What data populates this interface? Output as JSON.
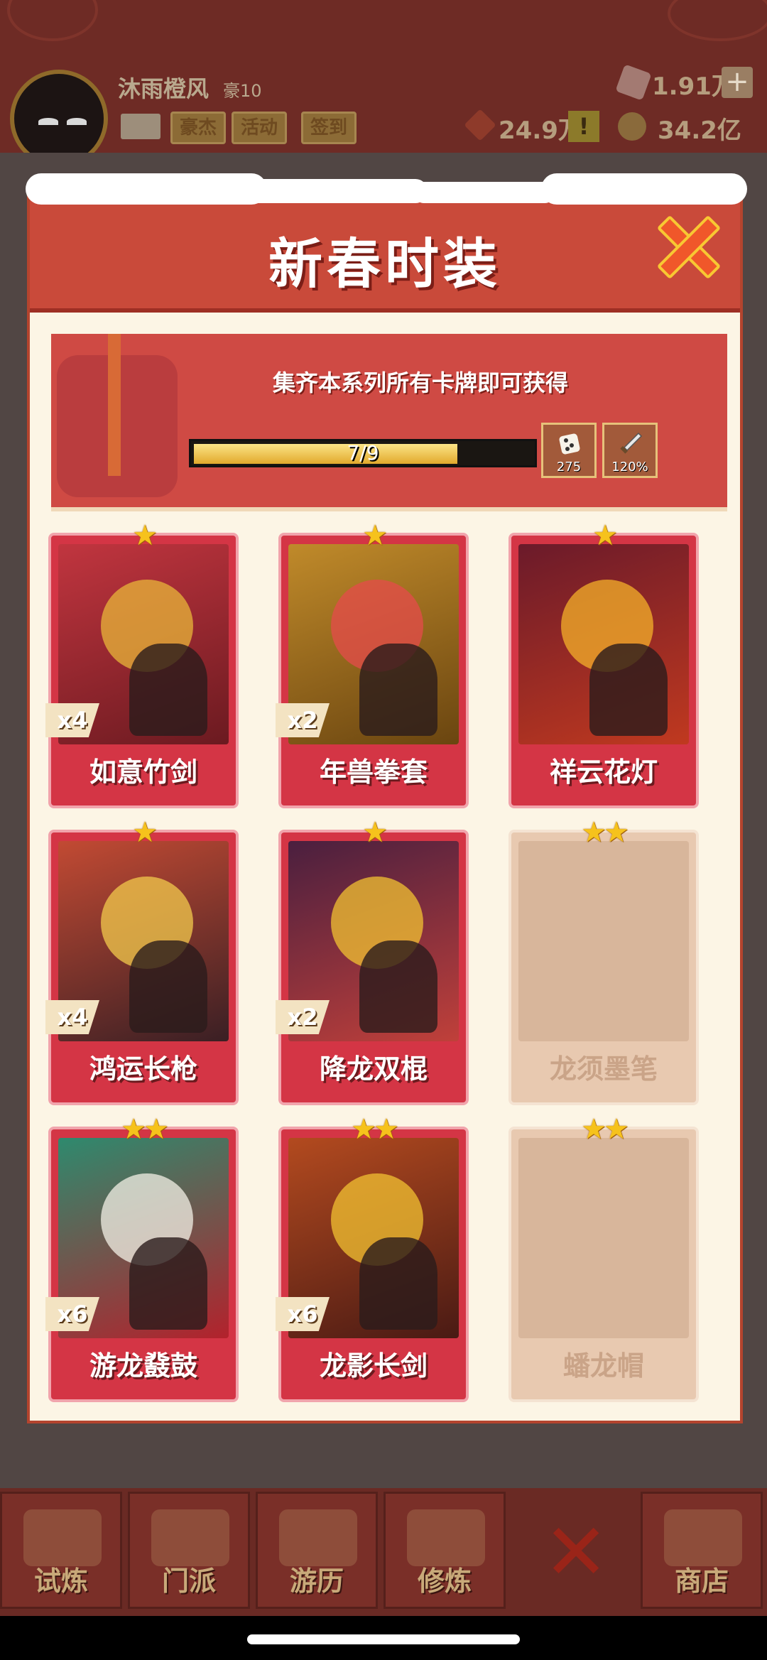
{
  "player": {
    "name": "沐雨橙风",
    "rank": "豪10",
    "buttons": [
      "豪杰",
      "活动",
      "签到"
    ]
  },
  "resources": {
    "gems": "1.91万",
    "tokens": "24.9万",
    "gold": "34.2亿"
  },
  "modal": {
    "title": "新春时装",
    "banner_text": "集齐本系列所有卡牌即可获得",
    "progress_text": "7/9",
    "progress_fraction": 0.78,
    "rewards": [
      {
        "icon": "dice-icon",
        "value": "275"
      },
      {
        "icon": "sword-icon",
        "value": "120%"
      }
    ],
    "cards": [
      {
        "name": "如意竹剑",
        "stars": "★",
        "qty": "x4",
        "owned": true
      },
      {
        "name": "年兽拳套",
        "stars": "★",
        "qty": "x2",
        "owned": true
      },
      {
        "name": "祥云花灯",
        "stars": "★",
        "qty": "",
        "owned": true
      },
      {
        "name": "鸿运长枪",
        "stars": "★",
        "qty": "x4",
        "owned": true
      },
      {
        "name": "降龙双棍",
        "stars": "★",
        "qty": "x2",
        "owned": true
      },
      {
        "name": "龙须墨笔",
        "stars": "★★",
        "qty": "",
        "owned": false
      },
      {
        "name": "游龙鼗鼓",
        "stars": "★★",
        "qty": "x6",
        "owned": true
      },
      {
        "name": "龙影长剑",
        "stars": "★★",
        "qty": "x6",
        "owned": true
      },
      {
        "name": "蟠龙帽",
        "stars": "★★",
        "qty": "",
        "owned": false
      }
    ]
  },
  "nav": {
    "tabs": [
      "试炼",
      "门派",
      "游历",
      "修炼",
      "",
      "商店"
    ]
  },
  "colors": {
    "modal_header": "#c94a3a",
    "card_red": "#d43545",
    "star_gold": "#f6c21c"
  }
}
